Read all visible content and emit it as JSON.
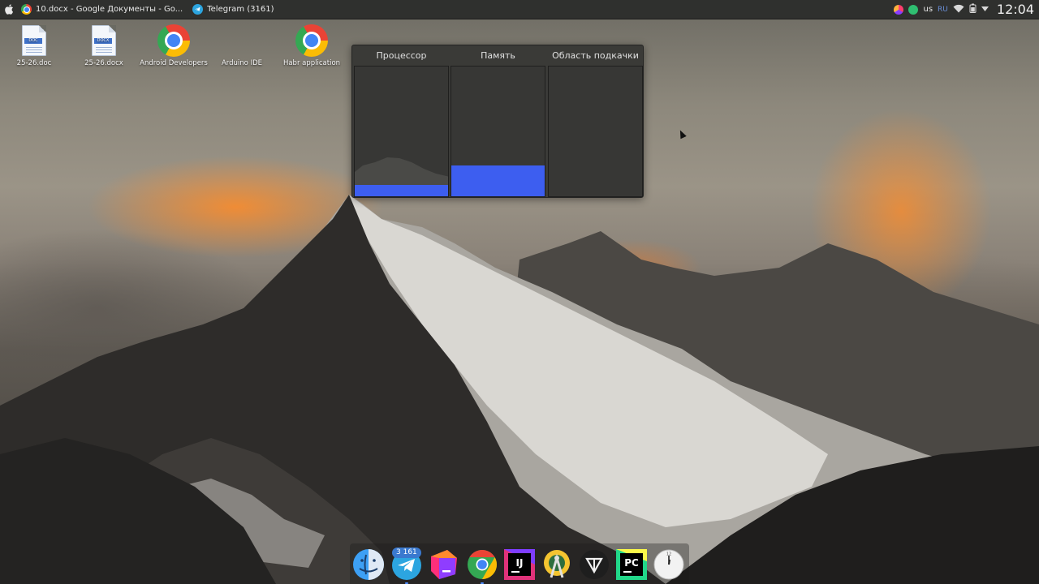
{
  "top_panel": {
    "apple_icon": "apple-icon",
    "tasks": [
      {
        "title": "10.docx - Google Документы - Go...",
        "icon": "chrome-icon"
      },
      {
        "title": "Telegram (3161)",
        "icon": "telegram-icon"
      }
    ],
    "tray": {
      "keyboard_layout": "us",
      "language_indicator": "RU",
      "clock": "12:04"
    }
  },
  "desktop_icons": [
    {
      "label": "25-26.doc",
      "icon": "doc-file-icon",
      "tag": "DOC"
    },
    {
      "label": "25-26.docx",
      "icon": "docx-file-icon",
      "tag": "DOCX"
    },
    {
      "label": "Android Developers",
      "icon": "chrome-icon"
    },
    {
      "label": "Arduino IDE",
      "icon": "arduino-icon"
    },
    {
      "label": "Habr application",
      "icon": "chrome-icon"
    }
  ],
  "system_monitor": {
    "columns": [
      {
        "title": "Процессор",
        "usage_fraction": 0.09
      },
      {
        "title": "Память",
        "usage_fraction": 0.24
      },
      {
        "title": "Область подкачки",
        "usage_fraction": 0.0
      }
    ]
  },
  "dock": {
    "items": [
      {
        "name": "finder-icon"
      },
      {
        "name": "telegram-icon",
        "badge": "3 161"
      },
      {
        "name": "jetbrains-toolbox-icon"
      },
      {
        "name": "chrome-icon"
      },
      {
        "name": "intellij-idea-icon",
        "text": "IJ"
      },
      {
        "name": "android-studio-icon"
      },
      {
        "name": "tor-browser-icon"
      },
      {
        "name": "pycharm-icon",
        "text": "PC"
      },
      {
        "name": "clock-icon",
        "text": "12"
      }
    ]
  },
  "colors": {
    "panel_bg": "#2f302e",
    "monitor_bar": "#3d5ef0",
    "accent": "#4d8cff"
  }
}
